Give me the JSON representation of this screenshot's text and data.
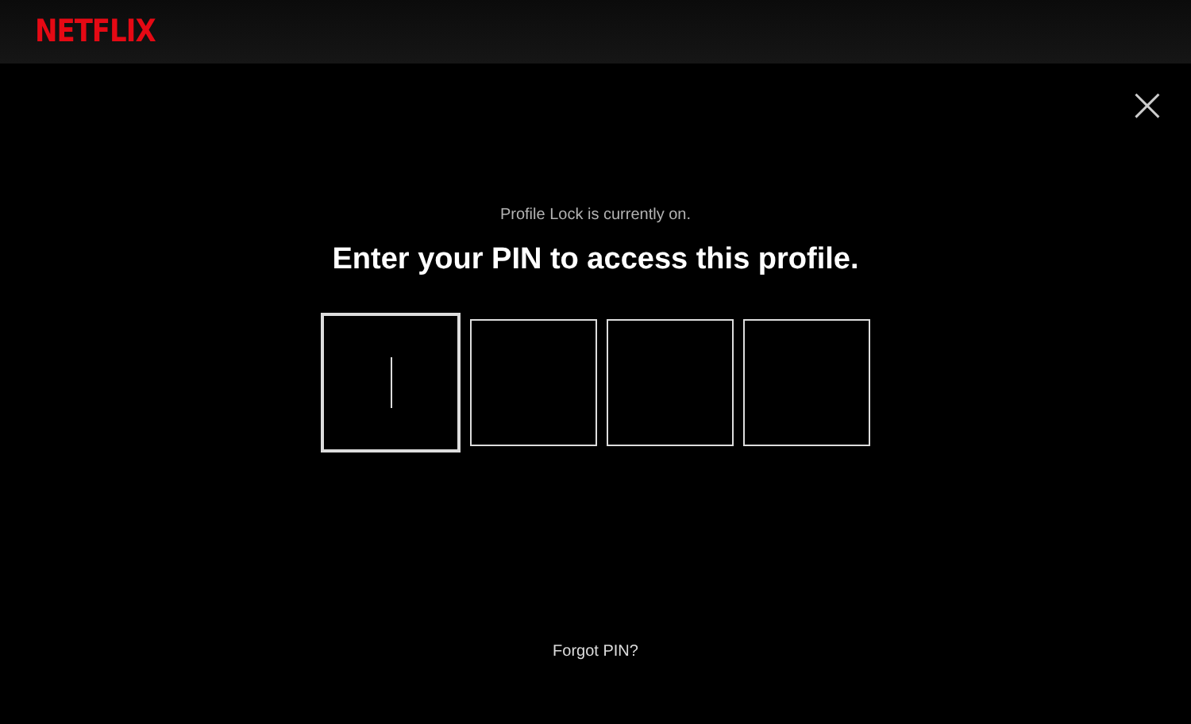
{
  "header": {
    "logo": "NETFLIX"
  },
  "dialog": {
    "close": "×",
    "status": "Profile Lock is currently on.",
    "title": "Enter your PIN to access this profile.",
    "pin_fields": [
      {
        "focused": true
      },
      {
        "focused": false
      },
      {
        "focused": false
      },
      {
        "focused": false
      }
    ],
    "forgot_link": "Forgot PIN?"
  }
}
